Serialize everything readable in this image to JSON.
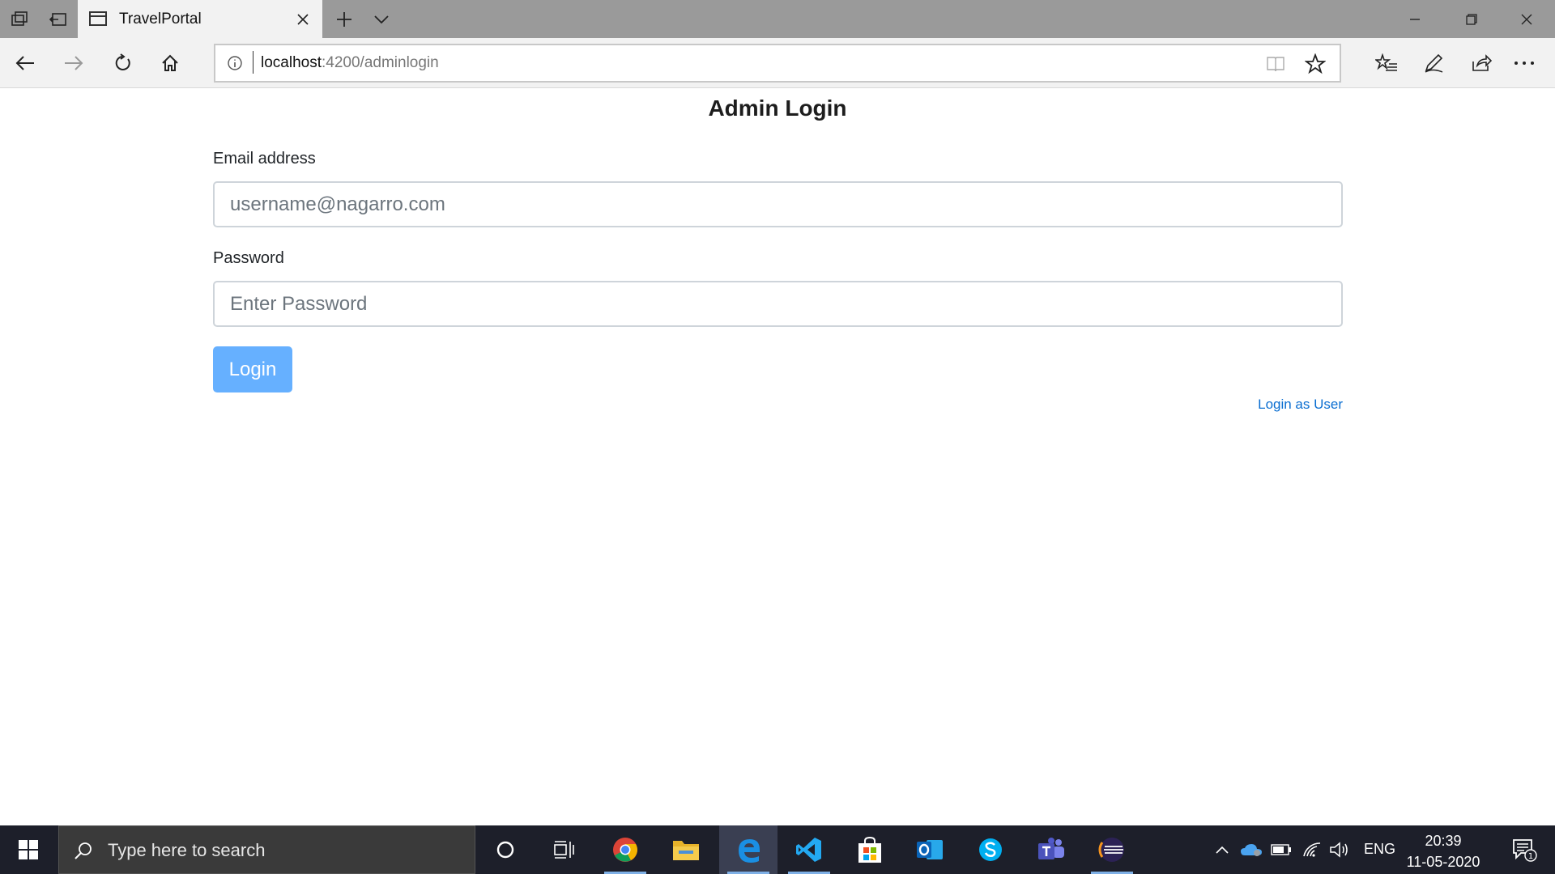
{
  "browser": {
    "tab_title": "TravelPortal",
    "url_host": "localhost",
    "url_path": ":4200/adminlogin"
  },
  "page": {
    "heading": "Admin Login",
    "email_label": "Email address",
    "email_placeholder": "username@nagarro.com",
    "password_label": "Password",
    "password_placeholder": "Enter Password",
    "login_button": "Login",
    "user_link": "Login as User"
  },
  "taskbar": {
    "search_placeholder": "Type here to search",
    "language": "ENG",
    "time": "20:39",
    "date": "11-05-2020",
    "notification_count": "1"
  },
  "colors": {
    "primary_button": "#66b0ff",
    "link": "#0a6ed1",
    "taskbar": "#1d1f2a"
  }
}
